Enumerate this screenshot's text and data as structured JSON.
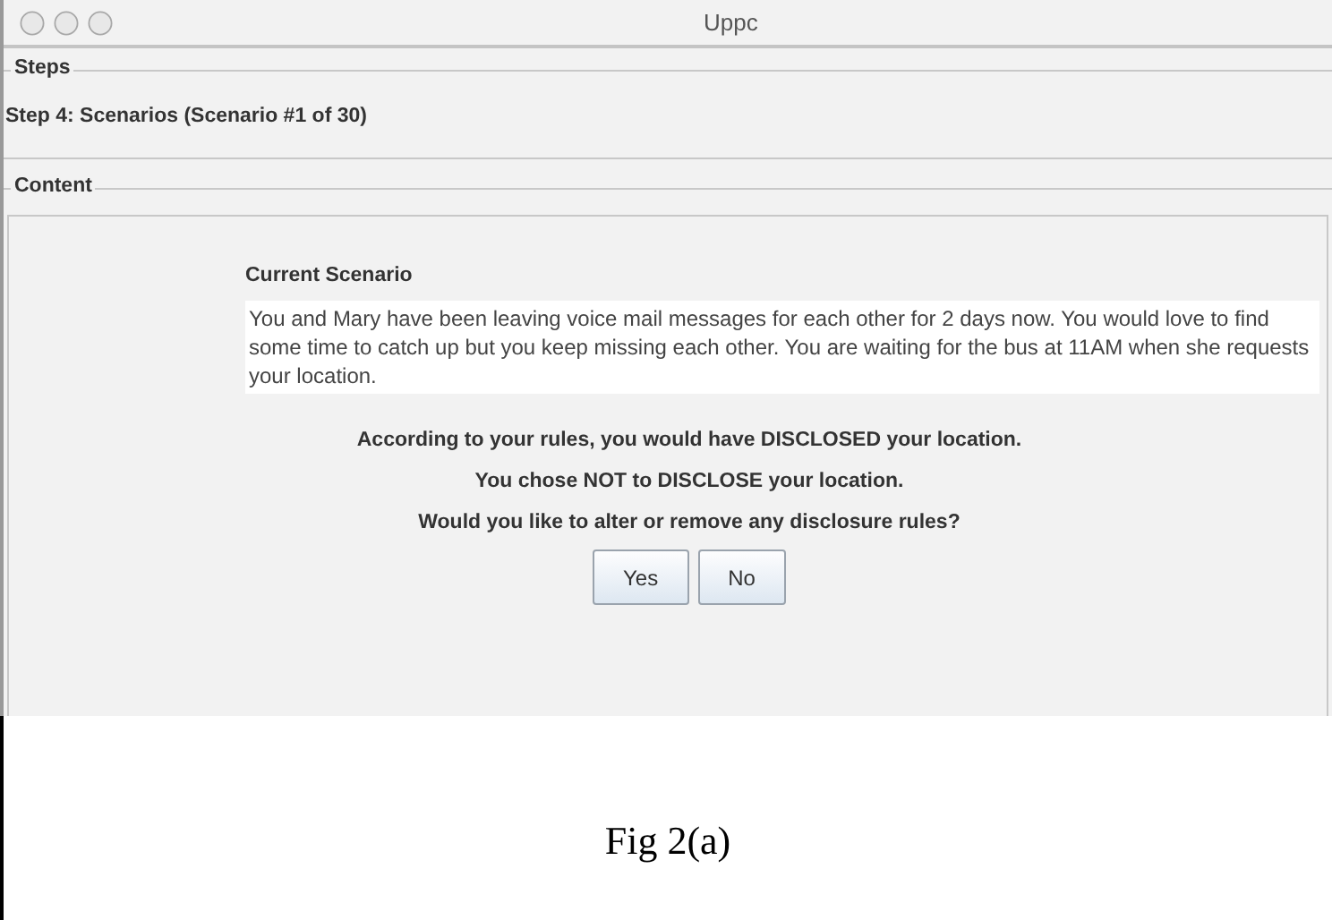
{
  "window": {
    "title": "Uppc"
  },
  "steps": {
    "legend": "Steps",
    "text": "Step 4: Scenarios (Scenario #1 of 30)"
  },
  "content": {
    "legend": "Content",
    "heading": "Current Scenario",
    "scenario": "You and Mary have been leaving voice mail messages for each other for 2 days now. You would love to find some time to catch up but you keep missing each other. You are waiting for the bus at 11AM when she requests your location.",
    "messages": [
      "According to your rules, you would have DISCLOSED your location.",
      "You chose NOT to DISCLOSE your location.",
      "Would you like to alter or remove any disclosure rules?"
    ],
    "buttons": [
      {
        "label": "Yes"
      },
      {
        "label": "No"
      }
    ]
  },
  "caption": "Fig 2(a)"
}
